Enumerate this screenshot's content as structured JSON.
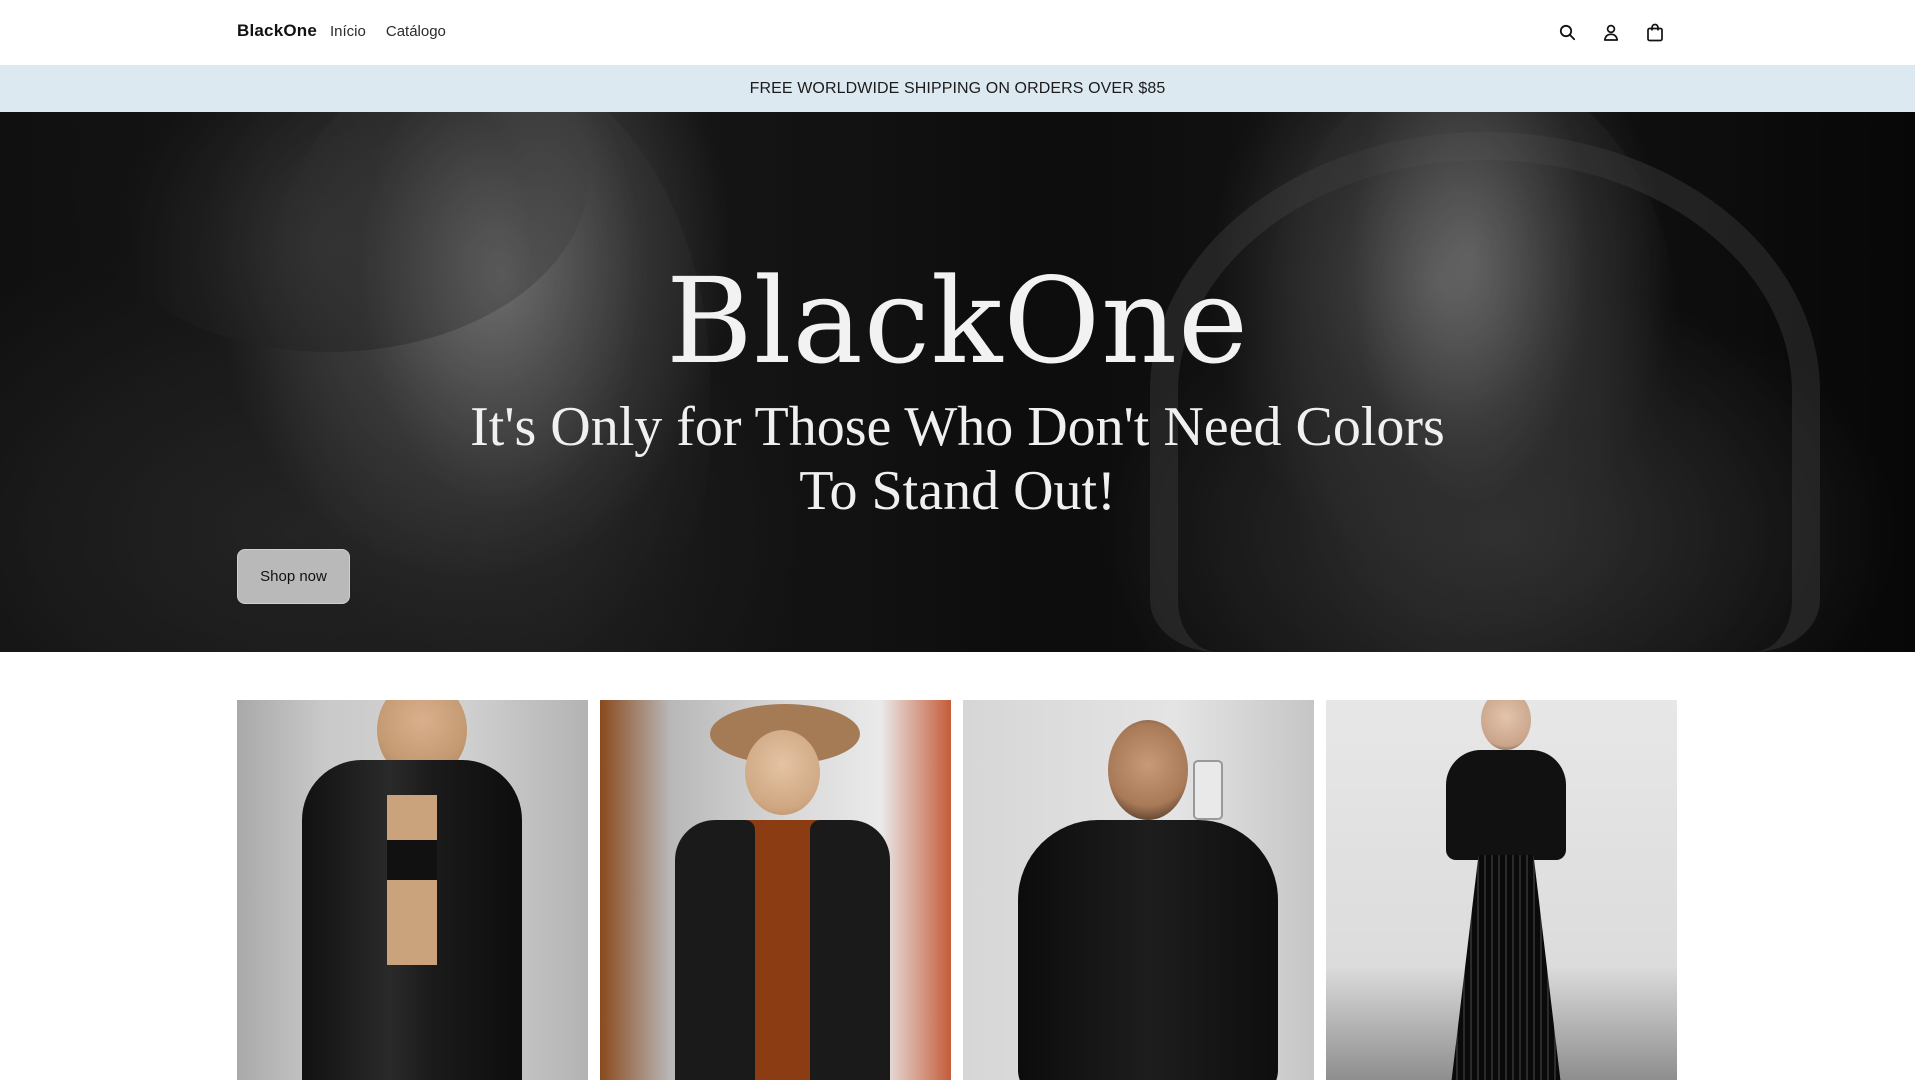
{
  "header": {
    "brand": "BlackOne",
    "nav": [
      {
        "label": "Início"
      },
      {
        "label": "Catálogo"
      }
    ],
    "icons": [
      "search-icon",
      "account-icon",
      "cart-icon"
    ]
  },
  "announcement": {
    "text": "FREE WORLDWIDE SHIPPING ON ORDERS OVER $85"
  },
  "hero": {
    "title": "BlackOne",
    "subtitle_line1": "It's Only for Those Who Don't Need Colors",
    "subtitle_line2": "To Stand Out!",
    "cta": "Shop now"
  },
  "products": [
    {
      "description": "black double-breasted blazer"
    },
    {
      "description": "black sherpa vest with brown hat"
    },
    {
      "description": "black zip-up jacket"
    },
    {
      "description": "black pleated midi dress"
    }
  ],
  "colors": {
    "announcement_bg": "#dde9f1",
    "hero_button_bg": "#b9b9b9",
    "text": "#121212"
  }
}
